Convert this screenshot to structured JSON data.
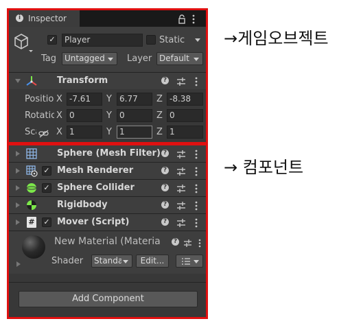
{
  "inspector": {
    "tab_label": "Inspector",
    "tab_icon": "info-icon",
    "lock_icon": "lock-icon",
    "menu_icon": "kebab-icon"
  },
  "gameobject": {
    "active": true,
    "name": "Player",
    "static_label": "Static",
    "static_checked": false,
    "tag_label": "Tag",
    "tag_value": "Untagged",
    "layer_label": "Layer",
    "layer_value": "Default"
  },
  "transform": {
    "title": "Transform",
    "position_label": "Position",
    "rotation_label": "Rotation",
    "scale_label": "Scale",
    "axis_x": "X",
    "axis_y": "Y",
    "axis_z": "Z",
    "position": {
      "x": "-7.61",
      "y": "6.77",
      "z": "-8.38"
    },
    "rotation": {
      "x": "0",
      "y": "0",
      "z": "0"
    },
    "scale": {
      "x": "1",
      "y": "1",
      "z": "1"
    }
  },
  "components": [
    {
      "name": "Sphere (Mesh Filter)",
      "icon": "grid-icon",
      "has_checkbox": false
    },
    {
      "name": "Mesh Renderer",
      "icon": "mesh-renderer-icon",
      "has_checkbox": true,
      "checked": true
    },
    {
      "name": "Sphere Collider",
      "icon": "sphere-collider-icon",
      "has_checkbox": true,
      "checked": true
    },
    {
      "name": "Rigidbody",
      "icon": "rigidbody-icon",
      "has_checkbox": false
    },
    {
      "name": "Mover (Script)",
      "icon": "script-icon",
      "has_checkbox": true,
      "checked": true
    }
  ],
  "material": {
    "name": "New Material (Materia",
    "shader_label": "Shader",
    "shader_value": "Standard",
    "edit_label": "Edit...",
    "list_icon": "list-icon"
  },
  "add_component_label": "Add Component",
  "annotations": {
    "gameobject": "→게임오브젝트",
    "components": "→ 컴포넌트"
  },
  "colors": {
    "panel": "#383838",
    "highlight": "#e01010",
    "collider_green": "#7ce84a"
  }
}
